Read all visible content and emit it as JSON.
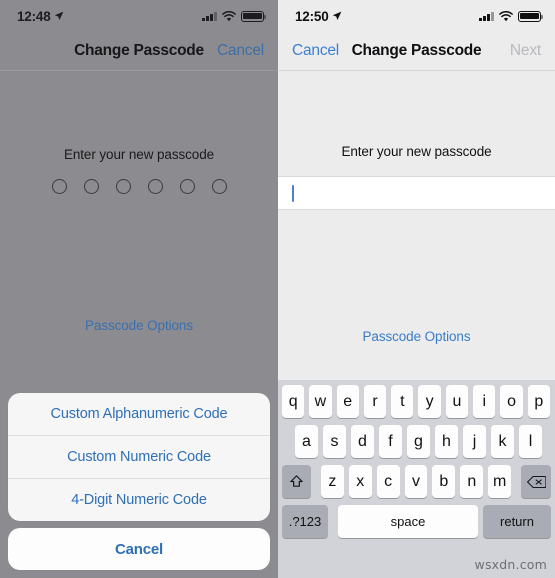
{
  "left_screen": {
    "status_bar": {
      "time": "12:48",
      "location_icon": "location-arrow-icon",
      "signal_icon": "cellular-signal-icon",
      "wifi_icon": "wifi-icon",
      "battery_icon": "battery-icon"
    },
    "nav": {
      "title": "Change Passcode",
      "right_button": "Cancel"
    },
    "prompt": "Enter your new passcode",
    "passcode_dots": 6,
    "passcode_options_link": "Passcode Options",
    "action_sheet": {
      "options": [
        "Custom Alphanumeric Code",
        "Custom Numeric Code",
        "4-Digit Numeric Code"
      ],
      "cancel": "Cancel"
    }
  },
  "right_screen": {
    "status_bar": {
      "time": "12:50",
      "location_icon": "location-arrow-icon",
      "signal_icon": "cellular-signal-icon",
      "wifi_icon": "wifi-icon",
      "battery_icon": "battery-icon"
    },
    "nav": {
      "left_button": "Cancel",
      "title": "Change Passcode",
      "right_button": "Next"
    },
    "prompt": "Enter your new passcode",
    "input": {
      "value": "",
      "placeholder": ""
    },
    "passcode_options_link": "Passcode Options",
    "keyboard": {
      "row1": [
        "q",
        "w",
        "e",
        "r",
        "t",
        "y",
        "u",
        "i",
        "o",
        "p"
      ],
      "row2": [
        "a",
        "s",
        "d",
        "f",
        "g",
        "h",
        "j",
        "k",
        "l"
      ],
      "row3": [
        "z",
        "x",
        "c",
        "v",
        "b",
        "n",
        "m"
      ],
      "shift_icon": "shift-arrow-icon",
      "delete_icon": "backspace-delete-icon",
      "numbers_key": ".?123",
      "space_key": "space",
      "return_key": "return"
    }
  },
  "watermark": "wsxdn.com",
  "colors": {
    "ios_blue": "#3c7fd4",
    "dimmed_overlay": "#8c8c90",
    "keyboard_bg": "#d1d3d8",
    "key_light": "#fdfdfd",
    "key_dark": "#a9acb4"
  }
}
